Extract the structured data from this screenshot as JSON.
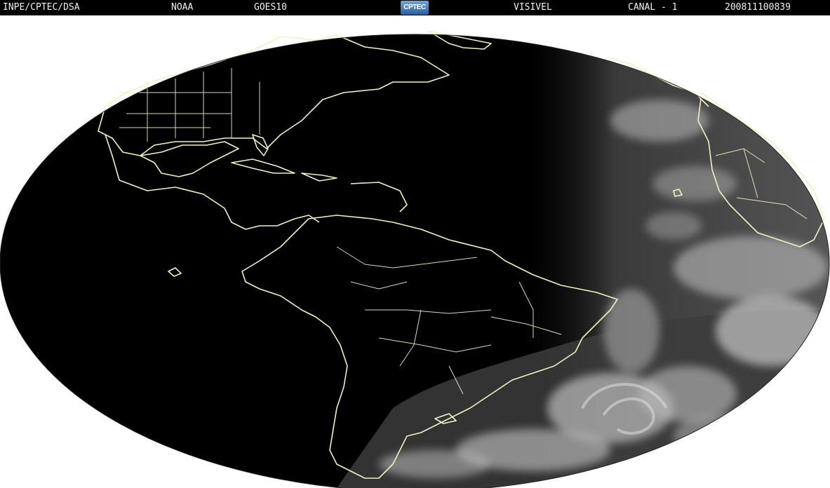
{
  "header": {
    "org": "INPE/CPTEC/DSA",
    "agency": "NOAA",
    "satellite": "GOES10",
    "logo_text": "CPTEC",
    "band": "VISIVEL",
    "channel": "CANAL - 1",
    "timestamp": "200811100839"
  },
  "colors": {
    "background": "#ffffff",
    "header_background": "#000000",
    "header_text": "#f2f2f2",
    "night_side": "#000000",
    "coastline": "#f5f0c0",
    "clouds": "#bdbdbd"
  },
  "map": {
    "projection": "full-disk ellipse",
    "content": "visible satellite image of the Americas and Atlantic Ocean with political boundaries"
  }
}
